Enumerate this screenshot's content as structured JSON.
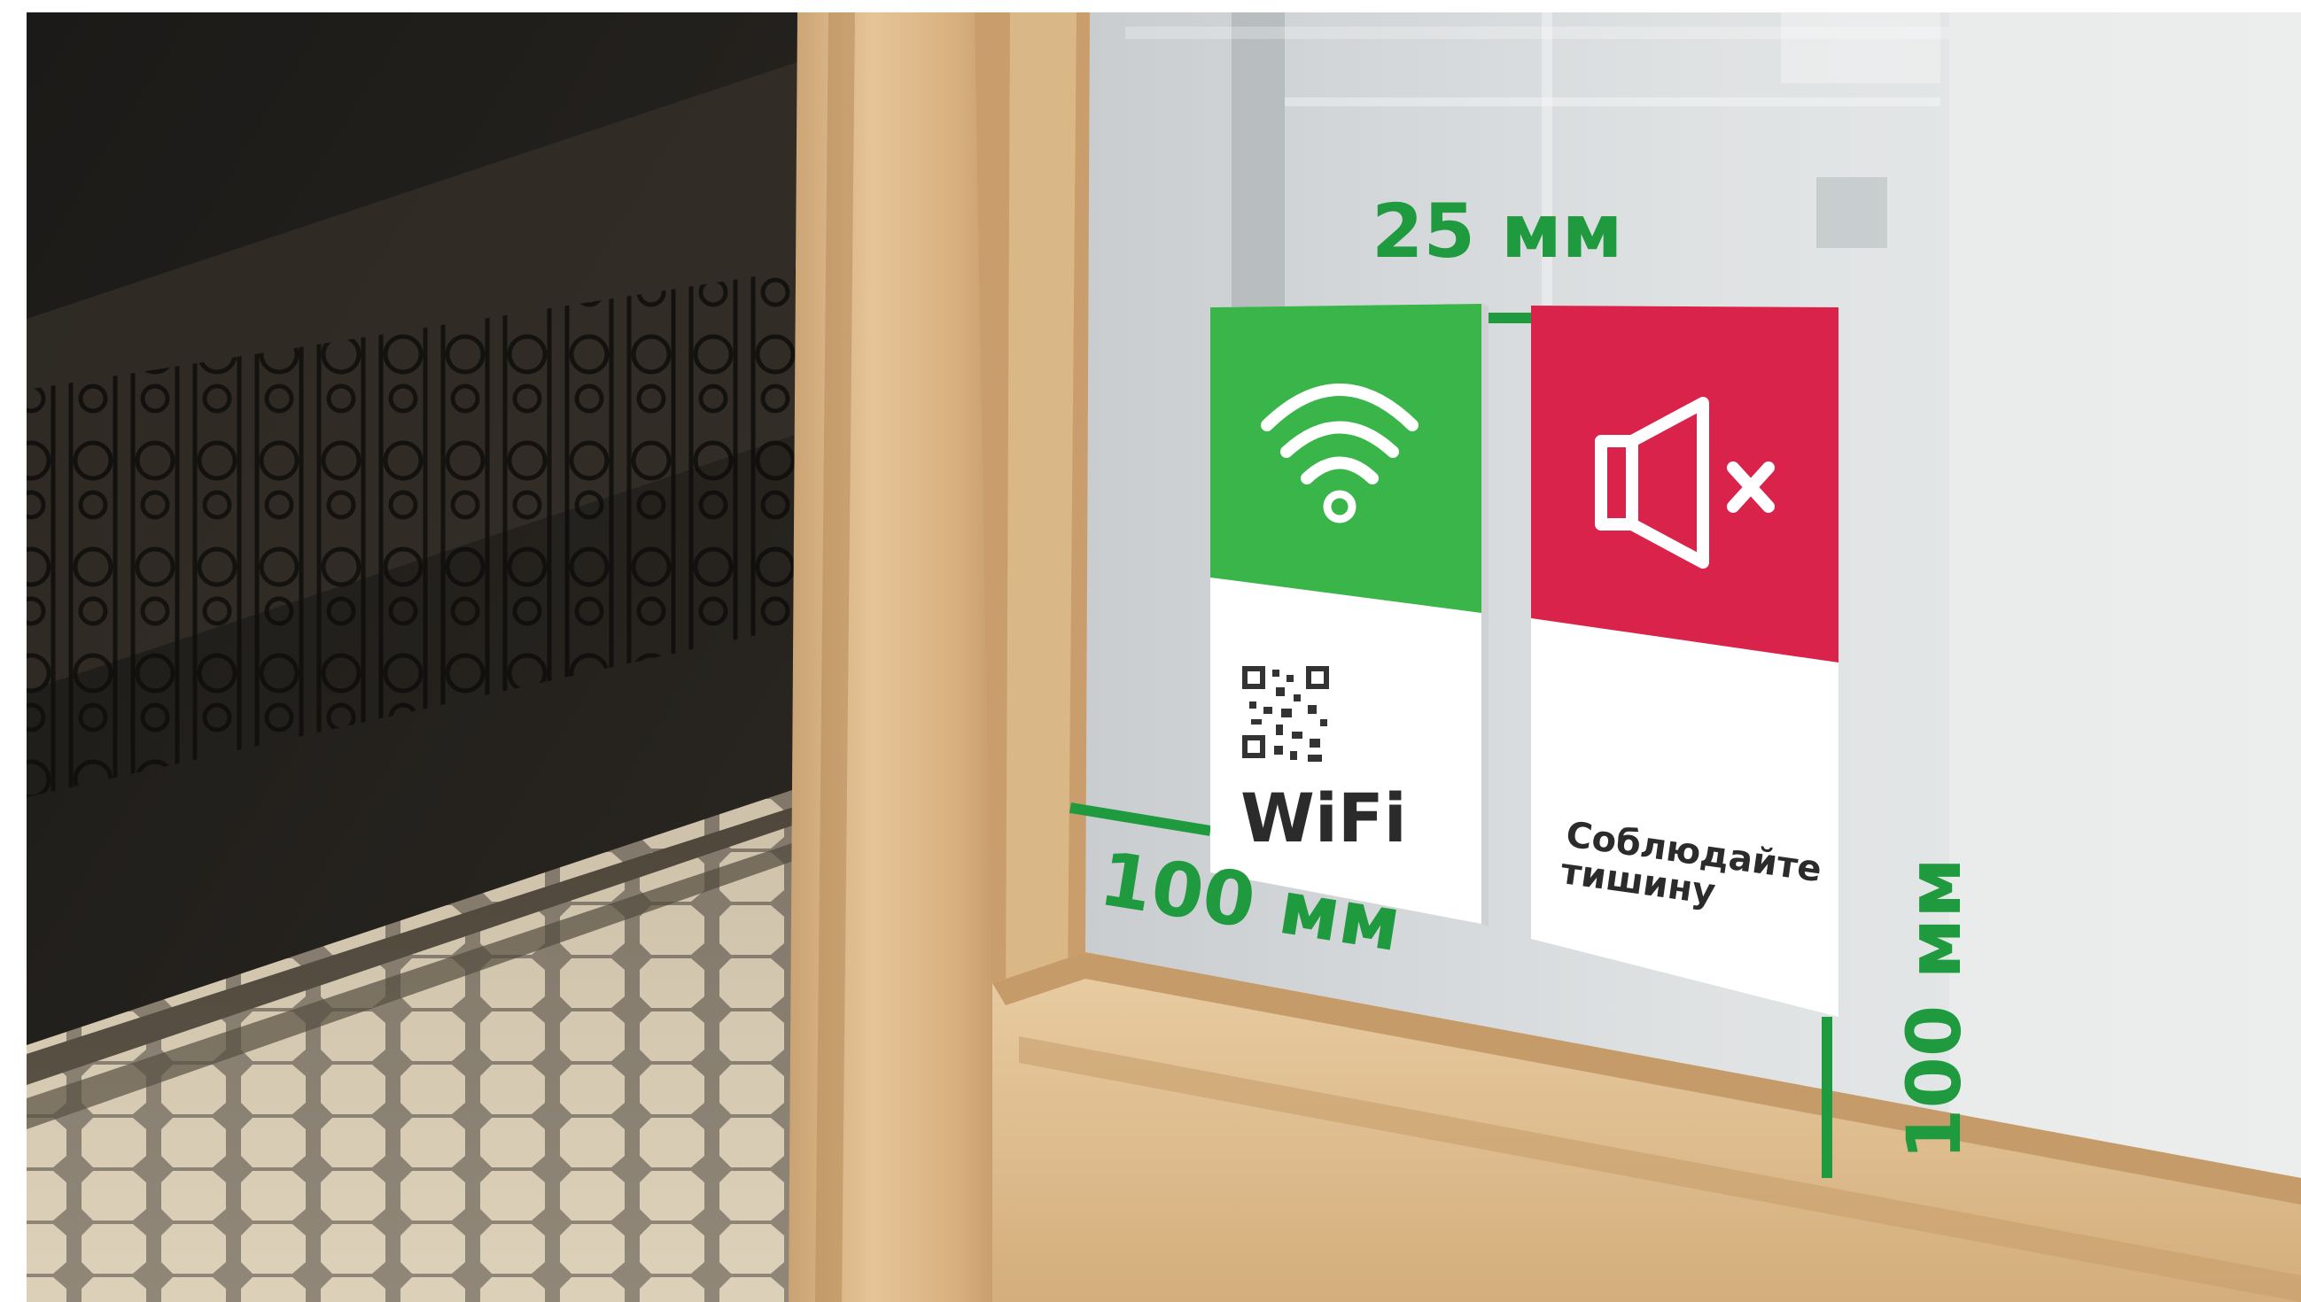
{
  "scene": {
    "measurements": {
      "gap_label": "25 мм",
      "left_offset_label": "100 мм",
      "bottom_offset_label": "100 мм"
    },
    "wifi_sign": {
      "icon": "wifi-icon",
      "qr": "qr-code-icon",
      "label": "WiFi",
      "color": "#3ab54a"
    },
    "silence_sign": {
      "icon": "speaker-mute-icon",
      "label_line1": "Соблюдайте",
      "label_line2": "тишину",
      "color": "#d9234a"
    },
    "measure_color": "#1f9a3f"
  }
}
